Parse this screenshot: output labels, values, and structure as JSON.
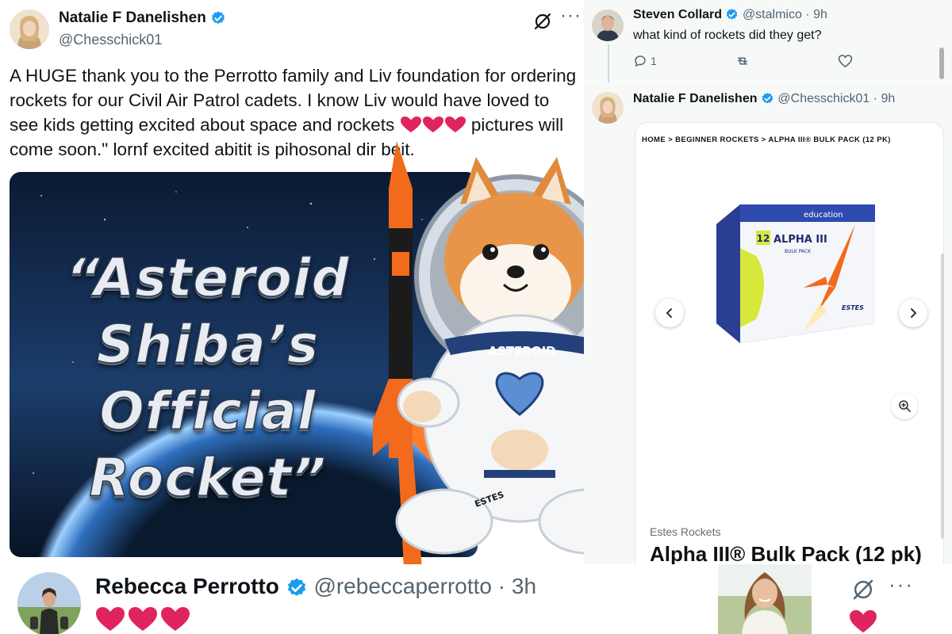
{
  "main_tweet": {
    "author_name": "Natalie F Danelishen",
    "handle": "@Chesschick01",
    "text_before_hearts": "A HUGE thank you to the Perrotto family and Liv foundation for ordering rockets for our Civil Air Patrol cadets. I know Liv would have loved to see kids getting excited about space and rockets",
    "text_after_hearts": " pictures will come soon.\" lornf excited abitit is pihosonal dir beit.",
    "more_label": "···",
    "image": {
      "poster_lines": [
        "“Asteroid",
        "Shiba’s",
        "Official",
        "Rocket”"
      ],
      "suit_badge": "ASTEROID",
      "rocket_decal": "ESTES"
    }
  },
  "reply_steven": {
    "author_name": "Steven Collard",
    "handle": "@stalmico",
    "time": "· 9h",
    "text": "what kind of rockets did they get?",
    "reply_count": "1"
  },
  "reply_natalie": {
    "author_name": "Natalie F Danelishen",
    "handle": "@Chesschick01",
    "time": "· 9h",
    "product_card": {
      "breadcrumb": "HOME > BEGINNER ROCKETS > ALPHA III® BULK PACK (12 PK)",
      "box_label_top": "education",
      "box_label_main": "ALPHA III",
      "box_label_sub": "BULK PACK",
      "box_count": "12",
      "box_brand": "ESTES",
      "brand": "Estes Rockets",
      "title": "Alpha III® Bulk Pack (12 pk)"
    }
  },
  "bottom_tweet": {
    "author_name": "Rebecca Perrotto",
    "handle": "@rebeccaperrotto",
    "time": "· 3h",
    "more_label": "···"
  },
  "colors": {
    "verified": "#1d9bf0",
    "heart": "#e0245e",
    "muted": "#536471",
    "rocket_orange": "#f26a1b"
  }
}
